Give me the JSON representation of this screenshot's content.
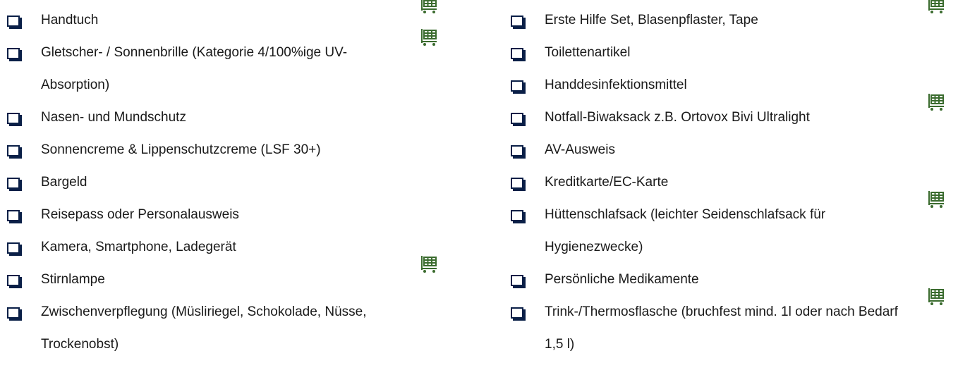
{
  "colors": {
    "checkbox_border": "#0a1f47",
    "cart_icon": "#3a6b2e",
    "text": "#1a1a1a"
  },
  "left_items": [
    {
      "label": "Handtuch",
      "cart": true
    },
    {
      "label": "Gletscher- / Sonnenbrille (Kategorie 4/100%ige UV-Absorption)",
      "cart": true
    },
    {
      "label": "Nasen- und Mundschutz",
      "cart": false
    },
    {
      "label": "Sonnencreme & Lippenschutzcreme (LSF 30+)",
      "cart": false
    },
    {
      "label": "Bargeld",
      "cart": false
    },
    {
      "label": "Reisepass oder Personalausweis",
      "cart": false
    },
    {
      "label": "Kamera, Smartphone, Ladegerät",
      "cart": false
    },
    {
      "label": "Stirnlampe",
      "cart": true
    },
    {
      "label": "Zwischenverpflegung (Müsliriegel, Schokolade, Nüsse, Trockenobst)",
      "cart": false
    }
  ],
  "right_items": [
    {
      "label": "Erste Hilfe Set, Blasenpflaster, Tape",
      "cart": true
    },
    {
      "label": "Toilettenartikel",
      "cart": false
    },
    {
      "label": "Handdesinfektionsmittel",
      "cart": false
    },
    {
      "label": "Notfall-Biwaksack z.B. Ortovox Bivi Ultralight",
      "cart": true
    },
    {
      "label": "AV-Ausweis",
      "cart": false
    },
    {
      "label": "Kreditkarte/EC-Karte",
      "cart": false
    },
    {
      "label": "Hüttenschlafsack (leichter Seidenschlafsack für Hygienezwecke)",
      "cart": true
    },
    {
      "label": "Persönliche Medikamente",
      "cart": false
    },
    {
      "label": "Trink-/Thermosflasche (bruchfest mind. 1l oder nach Bedarf 1,5 l)",
      "cart": true
    }
  ]
}
